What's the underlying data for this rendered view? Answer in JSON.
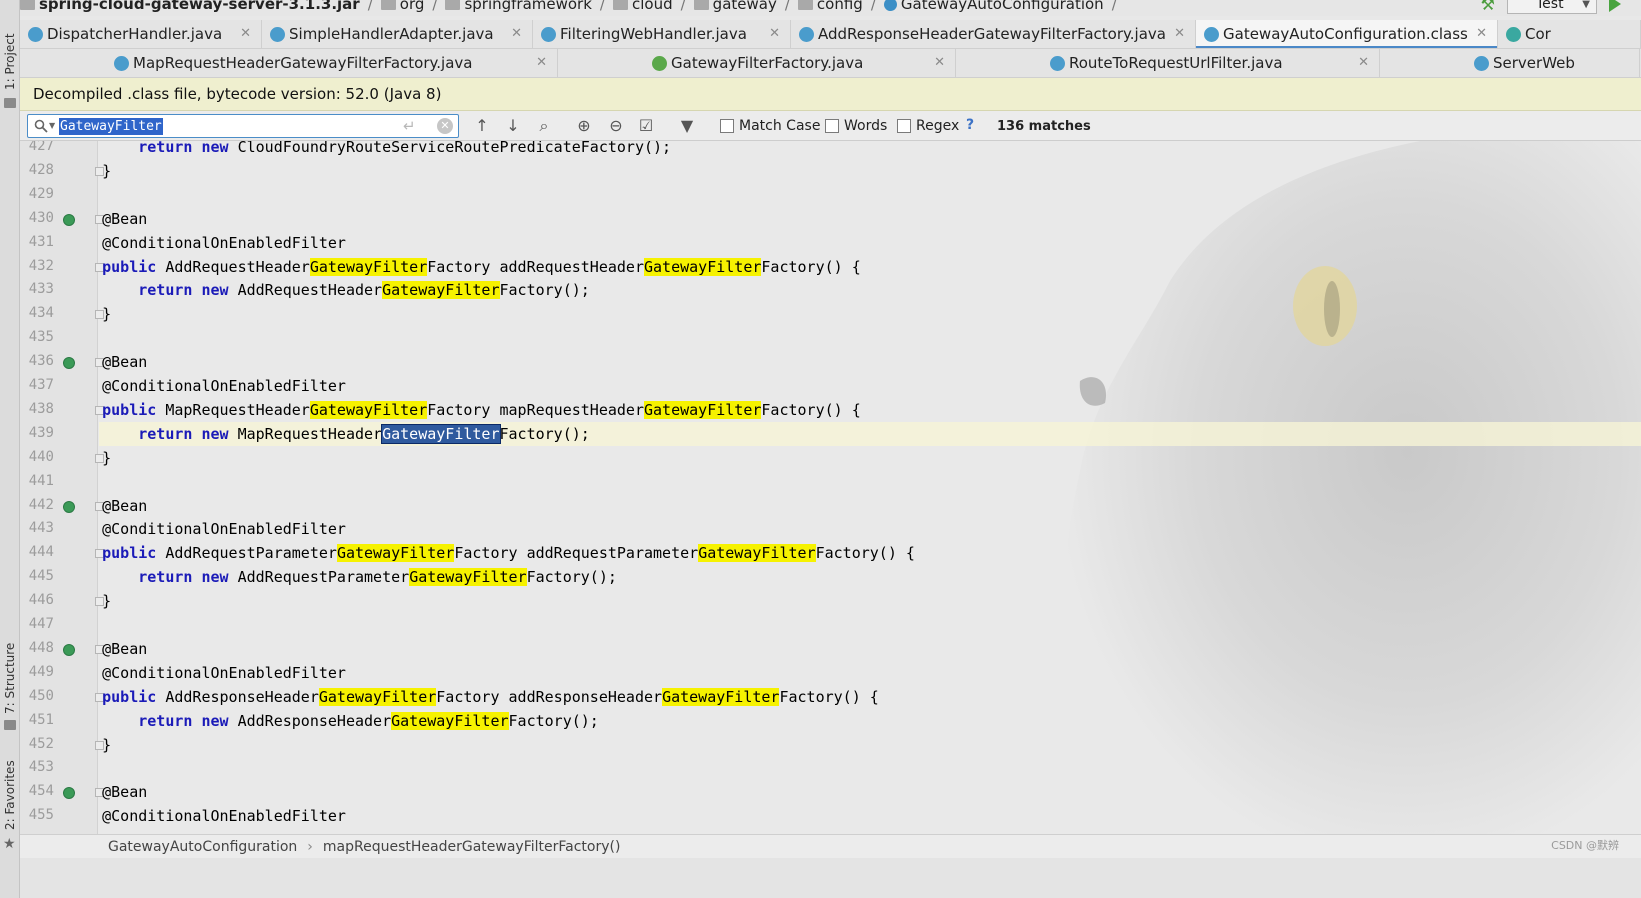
{
  "breadcrumb": {
    "jar": "spring-cloud-gateway-server-3.1.3.jar",
    "items": [
      "org",
      "springframework",
      "cloud",
      "gateway",
      "config",
      "GatewayAutoConfiguration"
    ],
    "run_config": "Test"
  },
  "side_tabs": {
    "project": "1: Project",
    "structure": "7: Structure",
    "favorites": "2: Favorites"
  },
  "tabs_row_1": [
    {
      "label": "DispatcherHandler.java",
      "type": "class"
    },
    {
      "label": "SimpleHandlerAdapter.java",
      "type": "class"
    },
    {
      "label": "FilteringWebHandler.java",
      "type": "class"
    },
    {
      "label": "AddResponseHeaderGatewayFilterFactory.java",
      "type": "class"
    },
    {
      "label": "GatewayAutoConfiguration.class",
      "type": "class",
      "active": true
    },
    {
      "label": "Cor",
      "type": "annotation"
    }
  ],
  "tabs_row_2": [
    {
      "label": "MapRequestHeaderGatewayFilterFactory.java",
      "type": "class"
    },
    {
      "label": "GatewayFilterFactory.java",
      "type": "interface"
    },
    {
      "label": "RouteToRequestUrlFilter.java",
      "type": "class"
    },
    {
      "label": "ServerWeb",
      "type": "class"
    }
  ],
  "banner": {
    "text": "Decompiled .class file, bytecode version: 52.0 (Java 8)"
  },
  "search": {
    "query": "GatewayFilter",
    "match_case": "Match Case",
    "words": "Words",
    "regex": "Regex",
    "help": "?",
    "matches": "136 matches"
  },
  "editor": {
    "lines": [
      {
        "n": "427",
        "code": "        return new CloudFoundryRouteServiceRoutePredicateFactory();"
      },
      {
        "n": "428",
        "code": "    }"
      },
      {
        "n": "429",
        "code": ""
      },
      {
        "n": "430",
        "code": "    @Bean",
        "bean": true
      },
      {
        "n": "431",
        "code": "    @ConditionalOnEnabledFilter"
      },
      {
        "n": "432",
        "code": "    public AddRequestHeaderGatewayFilterFactory addRequestHeaderGatewayFilterFactory() {"
      },
      {
        "n": "433",
        "code": "        return new AddRequestHeaderGatewayFilterFactory();"
      },
      {
        "n": "434",
        "code": "    }"
      },
      {
        "n": "435",
        "code": ""
      },
      {
        "n": "436",
        "code": "    @Bean",
        "bean": true
      },
      {
        "n": "437",
        "code": "    @ConditionalOnEnabledFilter"
      },
      {
        "n": "438",
        "code": "    public MapRequestHeaderGatewayFilterFactory mapRequestHeaderGatewayFilterFactory() {"
      },
      {
        "n": "439",
        "code": "        return new MapRequestHeaderGatewayFilterFactory();",
        "current": true
      },
      {
        "n": "440",
        "code": "    }"
      },
      {
        "n": "441",
        "code": ""
      },
      {
        "n": "442",
        "code": "    @Bean",
        "bean": true
      },
      {
        "n": "443",
        "code": "    @ConditionalOnEnabledFilter"
      },
      {
        "n": "444",
        "code": "    public AddRequestParameterGatewayFilterFactory addRequestParameterGatewayFilterFactory() {"
      },
      {
        "n": "445",
        "code": "        return new AddRequestParameterGatewayFilterFactory();"
      },
      {
        "n": "446",
        "code": "    }"
      },
      {
        "n": "447",
        "code": ""
      },
      {
        "n": "448",
        "code": "    @Bean",
        "bean": true
      },
      {
        "n": "449",
        "code": "    @ConditionalOnEnabledFilter"
      },
      {
        "n": "450",
        "code": "    public AddResponseHeaderGatewayFilterFactory addResponseHeaderGatewayFilterFactory() {"
      },
      {
        "n": "451",
        "code": "        return new AddResponseHeaderGatewayFilterFactory();"
      },
      {
        "n": "452",
        "code": "    }"
      },
      {
        "n": "453",
        "code": ""
      },
      {
        "n": "454",
        "code": "    @Bean",
        "bean": true
      },
      {
        "n": "455",
        "code": "    @ConditionalOnEnabledFilter"
      }
    ]
  },
  "statusbar": {
    "class_name": "GatewayAutoConfiguration",
    "separator": "›",
    "method_name": "mapRequestHeaderGatewayFilterFactory()",
    "watermark": "CSDN @默辨"
  },
  "colors": {
    "highlight": "#f6f200",
    "current_match": "#2f5a9e",
    "keyword": "#1b1bb8",
    "banner": "#efefcf"
  }
}
